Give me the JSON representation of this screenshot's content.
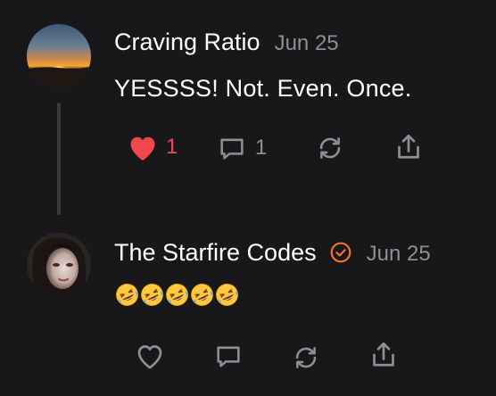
{
  "posts": [
    {
      "author": "Craving Ratio",
      "date": "Jun 25",
      "text": "YESSSS! Not. Even. Once.",
      "likes": "1",
      "replies": "1",
      "liked": true,
      "avatar_icon": "sunset-photo"
    },
    {
      "author": "The Starfire Codes",
      "date": "Jun 25",
      "verified": true,
      "emoji": [
        "rolling-on-floor-laughing",
        "rolling-on-floor-laughing",
        "rolling-on-floor-laughing",
        "rolling-on-floor-laughing",
        "rolling-on-floor-laughing"
      ],
      "emoji_text": "🤣🤣🤣🤣🤣",
      "likes": "",
      "replies": "",
      "liked": false,
      "avatar_icon": "profile-photo"
    }
  ],
  "colors": {
    "background": "#18181a",
    "like_red": "#f0474f",
    "muted": "#8e8e93",
    "verified_orange": "#f5722b",
    "thread_line": "#3a3a3d"
  }
}
